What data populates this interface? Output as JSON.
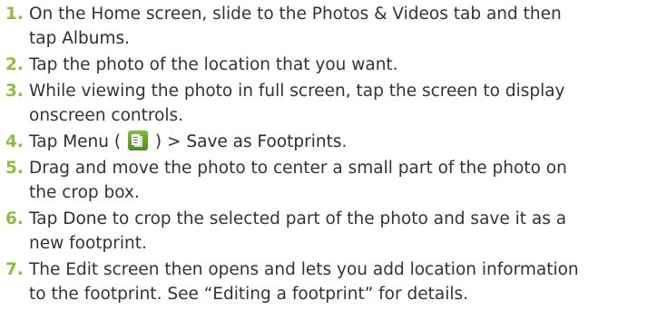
{
  "steps": [
    {
      "number": "1.",
      "lines": [
        [
          "On the Home screen, slide to the Photos & Videos tab and then"
        ],
        [
          "tap ",
          {
            "kw": "Albums"
          },
          "."
        ]
      ]
    },
    {
      "number": "2.",
      "lines": [
        [
          "Tap the photo of the location that you want."
        ]
      ]
    },
    {
      "number": "3.",
      "lines": [
        [
          "While viewing the photo in full screen, tap the screen to display"
        ],
        [
          "onscreen controls."
        ]
      ]
    },
    {
      "number": "4.",
      "lines": [
        [
          "Tap ",
          {
            "kw": "Menu"
          },
          " ( ",
          {
            "icon": "menu-icon"
          },
          " ) > ",
          {
            "kw": "Save as Footprints"
          },
          "."
        ]
      ]
    },
    {
      "number": "5.",
      "lines": [
        [
          "Drag and move the photo to center a small part of the photo on"
        ],
        [
          "the crop box."
        ]
      ]
    },
    {
      "number": "6.",
      "lines": [
        [
          "Tap ",
          {
            "kw": "Done"
          },
          " to crop the selected part of the photo and save it as a"
        ],
        [
          "new footprint."
        ]
      ]
    },
    {
      "number": "7.",
      "lines": [
        [
          "The Edit screen then opens and lets you add location information"
        ],
        [
          "to the footprint. See “Editing a footprint” for details."
        ]
      ]
    }
  ]
}
